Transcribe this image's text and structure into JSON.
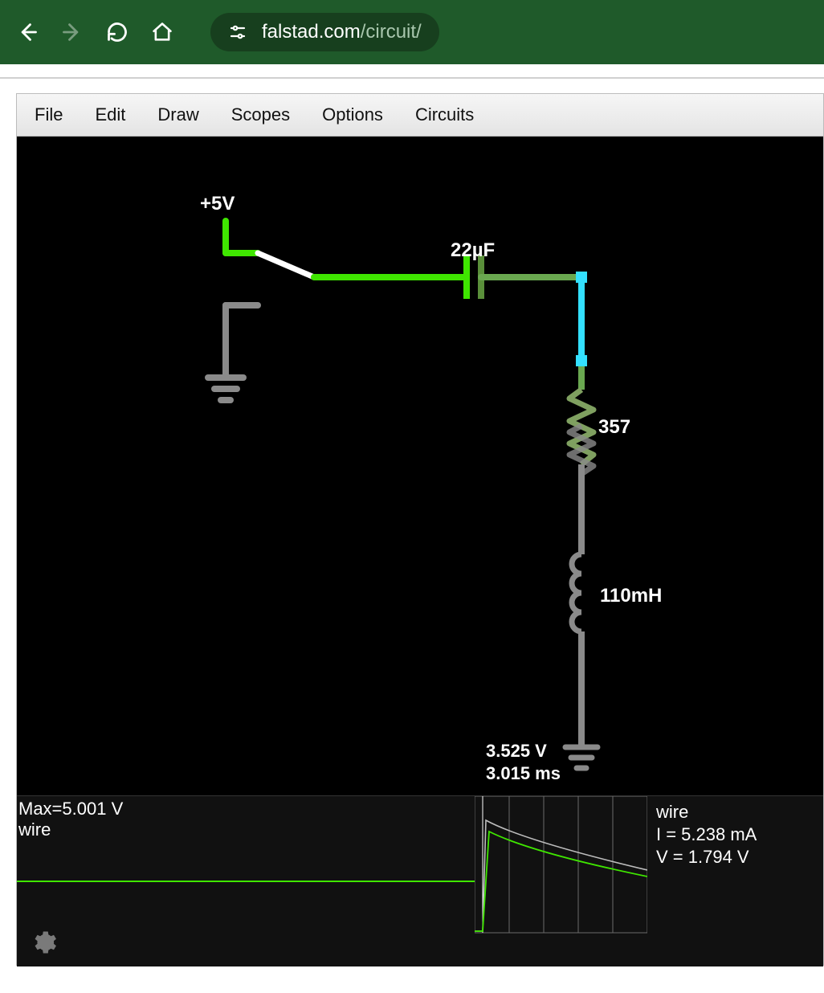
{
  "browser": {
    "url_host": "falstad.com",
    "url_path": "/circuit/"
  },
  "menu": {
    "file": "File",
    "edit": "Edit",
    "draw": "Draw",
    "scopes": "Scopes",
    "options": "Options",
    "circuits": "Circuits"
  },
  "circuit": {
    "source_label": "+5V",
    "capacitor_label": "22µF",
    "resistor_label": "357",
    "inductor_label": "110mH",
    "voltage_readout": "3.525 V",
    "time_readout": "3.015 ms"
  },
  "scope": {
    "max_label": "Max=5.001 V",
    "name_left": "wire",
    "name_right": "wire",
    "current_line": "I = 5.238 mA",
    "voltage_line": "V = 1.794 V"
  },
  "colors": {
    "green": "#3fe600",
    "dimgreen": "#5a8f3a",
    "cyan": "#33e0ff",
    "gray": "#8a8a8a",
    "white": "#ffffff"
  }
}
